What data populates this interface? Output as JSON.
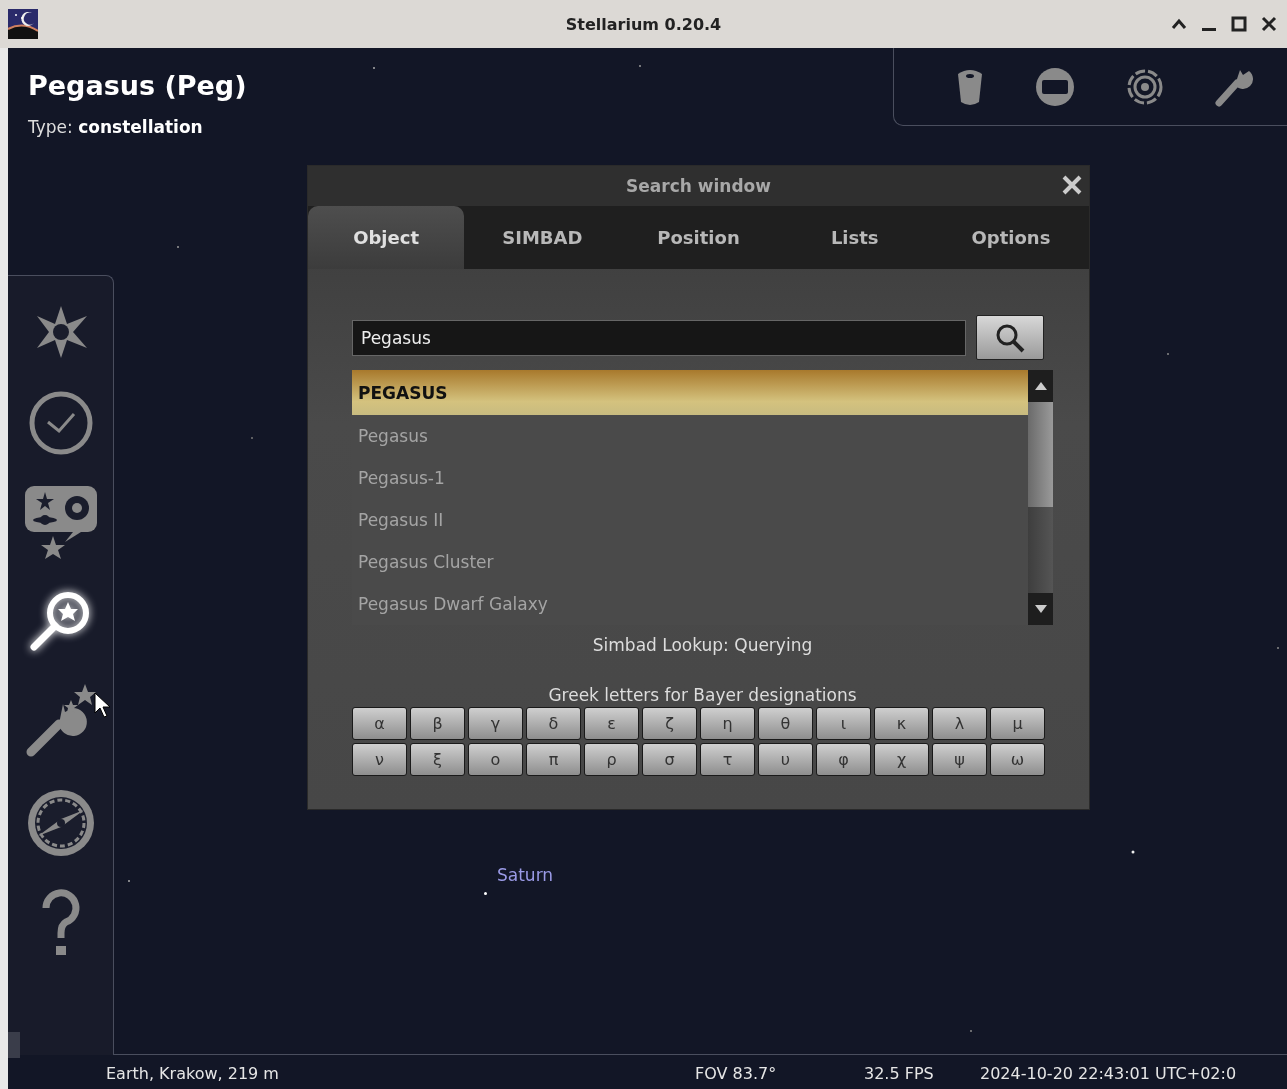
{
  "window": {
    "title": "Stellarium 0.20.4"
  },
  "object_info": {
    "name": "Pegasus (Peg)",
    "type_label": "Type:",
    "type_value": "constellation"
  },
  "left_toolbar": [
    {
      "kind": "location",
      "selected": false
    },
    {
      "kind": "datetime",
      "selected": false
    },
    {
      "kind": "sky",
      "selected": false
    },
    {
      "kind": "search",
      "selected": true
    },
    {
      "kind": "configuration",
      "selected": false
    },
    {
      "kind": "calculations",
      "selected": false
    },
    {
      "kind": "help",
      "selected": false
    }
  ],
  "sky_labels": [
    {
      "name": "Saturn"
    }
  ],
  "search_window": {
    "title": "Search window",
    "tabs": [
      {
        "label": "Object",
        "selected": true
      },
      {
        "label": "SIMBAD",
        "selected": false
      },
      {
        "label": "Position",
        "selected": false
      },
      {
        "label": "Lists",
        "selected": false
      },
      {
        "label": "Options",
        "selected": false
      }
    ],
    "search_field": {
      "value": "Pegasus"
    },
    "results": [
      {
        "label": "PEGASUS",
        "selected": true
      },
      {
        "label": "Pegasus",
        "selected": false
      },
      {
        "label": "Pegasus-1",
        "selected": false
      },
      {
        "label": "Pegasus II",
        "selected": false
      },
      {
        "label": "Pegasus Cluster",
        "selected": false
      },
      {
        "label": "Pegasus Dwarf Galaxy",
        "selected": false
      }
    ],
    "status": "Simbad Lookup: Querying",
    "greek_label": "Greek letters for Bayer designations",
    "greek_letters": [
      "α",
      "β",
      "γ",
      "δ",
      "ε",
      "ζ",
      "η",
      "θ",
      "ι",
      "κ",
      "λ",
      "μ",
      "ν",
      "ξ",
      "ο",
      "π",
      "ρ",
      "σ",
      "τ",
      "υ",
      "φ",
      "χ",
      "ψ",
      "ω"
    ]
  },
  "status_bar": {
    "location": "Earth, Krakow, 219 m",
    "fov": "FOV 83.7°",
    "fps": "32.5 FPS",
    "datetime": "2024-10-20 22:43:01 UTC+02:0"
  }
}
